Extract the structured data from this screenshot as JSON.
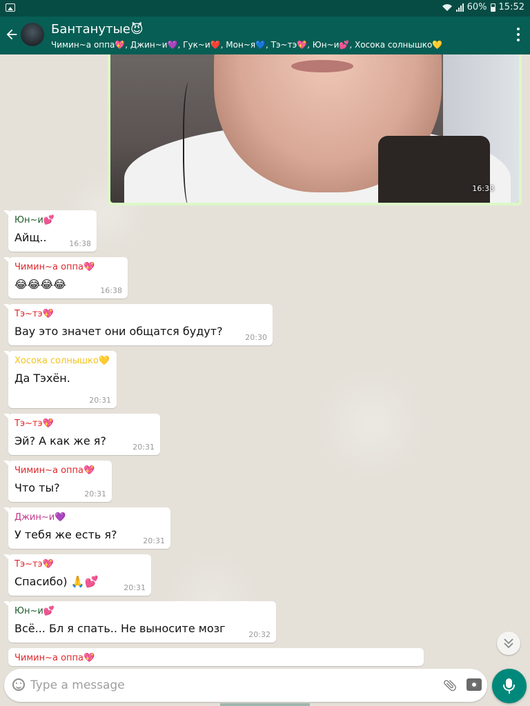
{
  "status_bar": {
    "battery": "60%",
    "time": "15:52"
  },
  "header": {
    "title": "Бантанутые😈",
    "subtitle": "Чимин~а оппа💖, Джин~и💜, Гук~и❤️, Мон~я💙, Тэ~тэ💖, Юн~и💕, Хосока солнышко💛"
  },
  "image_message": {
    "time": "16:38"
  },
  "messages": [
    {
      "sender": "Юн~и💕",
      "color": "#1d5a2a",
      "text": "Айщ..",
      "time": "16:38"
    },
    {
      "sender": "Чимин~а оппа💖",
      "color": "#e0262a",
      "text": "😂😂😂😂",
      "time": "16:38"
    },
    {
      "sender": "Тэ~тэ💖",
      "color": "#e0262a",
      "text": "Вау это значет они общатся будут?",
      "time": "20:30"
    },
    {
      "sender": "Хосока солнышко💛",
      "color": "#f3c31c",
      "text": "Да Тэхён.",
      "time": "20:31"
    },
    {
      "sender": "Тэ~тэ💖",
      "color": "#e0262a",
      "text": "Эй? А как же я?",
      "time": "20:31"
    },
    {
      "sender": "Чимин~а оппа💖",
      "color": "#e0262a",
      "text": "Что ты?",
      "time": "20:31"
    },
    {
      "sender": "Джин~и💜",
      "color": "#c2378a",
      "text": "У тебя же есть я?",
      "time": "20:31"
    },
    {
      "sender": "Тэ~тэ💖",
      "color": "#e0262a",
      "text": "Спасибо) 🙏💕",
      "time": "20:31"
    },
    {
      "sender": "Юн~и💕",
      "color": "#1d5a2a",
      "text": "Всё... Бл я спать.. Не выносите мозг",
      "time": "20:32"
    },
    {
      "sender": "Чимин~а оппа💖",
      "color": "#e0262a",
      "text": "",
      "time": ""
    }
  ],
  "input": {
    "placeholder": "Type a message"
  },
  "icons": {
    "back": "arrow-left-icon",
    "more": "more-vert-icon",
    "emoji": "emoji-icon",
    "attach": "paperclip-icon",
    "camera": "camera-icon",
    "mic": "mic-icon",
    "scroll_down": "double-chevron-down-icon"
  },
  "colors": {
    "header": "#075e54",
    "status_bar": "#074c44",
    "outgoing_bubble": "#dcf8c6",
    "incoming_bubble": "#ffffff",
    "mic_button": "#00897b"
  }
}
